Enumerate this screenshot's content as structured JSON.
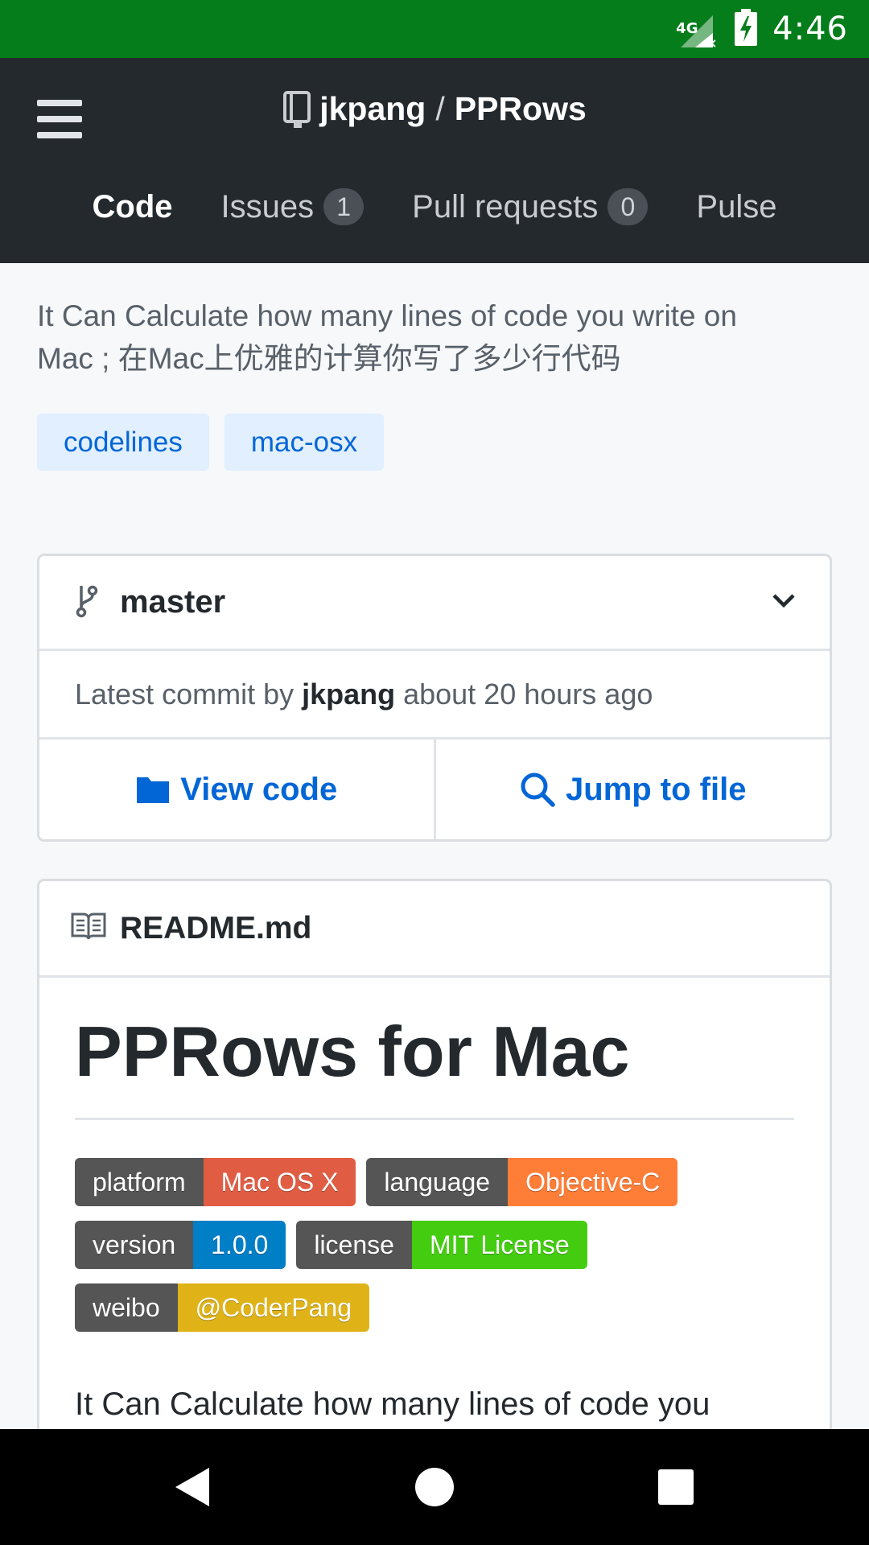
{
  "status_bar": {
    "network": "4G",
    "time": "4:46"
  },
  "header": {
    "owner": "jkpang",
    "separator": "/",
    "repo": "PPRows",
    "tabs": [
      {
        "label": "Code",
        "count": null,
        "active": true
      },
      {
        "label": "Issues",
        "count": "1",
        "active": false
      },
      {
        "label": "Pull requests",
        "count": "0",
        "active": false
      },
      {
        "label": "Pulse",
        "count": null,
        "active": false
      }
    ]
  },
  "description": {
    "line1": "It Can Calculate how many lines of code you write on",
    "line2": "Mac ; 在Mac上优雅的计算你写了多少行代码"
  },
  "topics": [
    "codelines",
    "mac-osx"
  ],
  "branch": {
    "name": "master",
    "commit_prefix": "Latest commit by",
    "commit_author": "jkpang",
    "commit_time": "about 20 hours ago",
    "view_code": "View code",
    "jump_to_file": "Jump to file"
  },
  "readme": {
    "filename": "README.md",
    "title": "PPRows for Mac",
    "badges": [
      {
        "label": "platform",
        "value": "Mac OS X",
        "color": "#e05d44"
      },
      {
        "label": "language",
        "value": "Objective-C",
        "color": "#fe7d37"
      },
      {
        "label": "version",
        "value": "1.0.0",
        "color": "#007ec6"
      },
      {
        "label": "license",
        "value": "MIT License",
        "color": "#4c1"
      },
      {
        "label": "weibo",
        "value": "@CoderPang",
        "color": "#dfb317"
      }
    ],
    "paragraph": "It Can Calculate how many lines of code you"
  },
  "colors": {
    "status_bar": "#067d1b",
    "header_bg": "#24292e",
    "link": "#0366d6",
    "topic_bg": "#e1efff"
  },
  "icons": {
    "menu": "hamburger-icon",
    "repo": "repo-book-icon",
    "branch": "git-branch-icon",
    "folder": "folder-icon",
    "search": "search-icon",
    "book": "book-icon"
  }
}
